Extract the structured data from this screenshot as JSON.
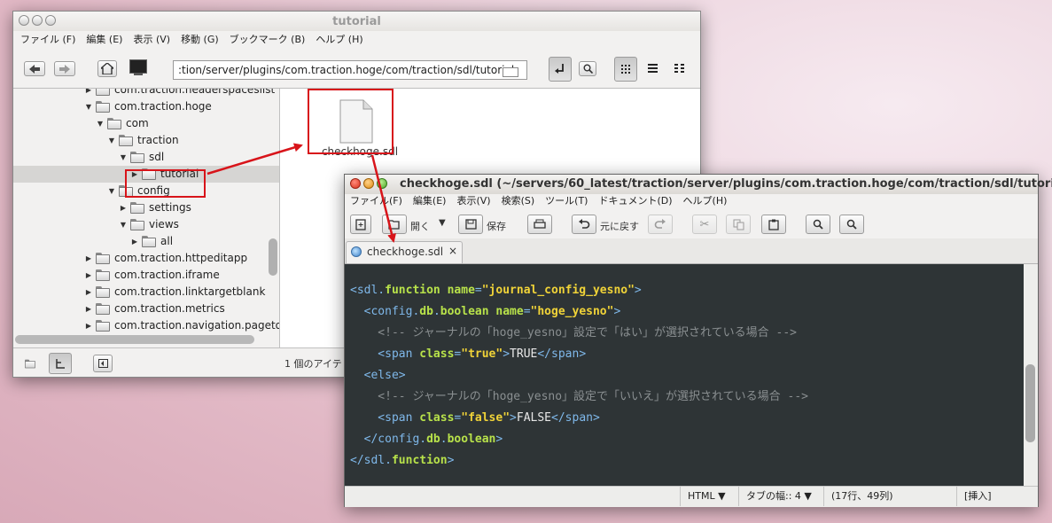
{
  "file_manager": {
    "title": "tutorial",
    "menu": [
      "ファイル (F)",
      "編集 (E)",
      "表示 (V)",
      "移動 (G)",
      "ブックマーク (B)",
      "ヘルプ (H)"
    ],
    "path": ":tion/server/plugins/com.traction.hoge/com/traction/sdl/tutorial",
    "tree": [
      {
        "label": "com.traction.headerspaceslist",
        "indent": 0,
        "expanded": false
      },
      {
        "label": "com.traction.hoge",
        "indent": 0,
        "expanded": true
      },
      {
        "label": "com",
        "indent": 1,
        "expanded": true
      },
      {
        "label": "traction",
        "indent": 2,
        "expanded": true
      },
      {
        "label": "sdl",
        "indent": 3,
        "expanded": true
      },
      {
        "label": "tutorial",
        "indent": 4,
        "expanded": false,
        "selected": true
      },
      {
        "label": "config",
        "indent": 2,
        "expanded": true
      },
      {
        "label": "settings",
        "indent": 3,
        "expanded": false
      },
      {
        "label": "views",
        "indent": 3,
        "expanded": true
      },
      {
        "label": "all",
        "indent": 4,
        "expanded": false
      },
      {
        "label": "com.traction.httpeditapp",
        "indent": 0,
        "expanded": false
      },
      {
        "label": "com.traction.iframe",
        "indent": 0,
        "expanded": false
      },
      {
        "label": "com.traction.linktargetblank",
        "indent": 0,
        "expanded": false
      },
      {
        "label": "com.traction.metrics",
        "indent": 0,
        "expanded": false
      },
      {
        "label": "com.traction.navigation.pageto",
        "indent": 0,
        "expanded": false
      }
    ],
    "file_name": "checkhoge.sdl",
    "status": "1 個のアイテ"
  },
  "editor": {
    "title": "checkhoge.sdl (~/servers/60_latest/traction/server/plugins/com.traction.hoge/com/traction/sdl/tutorial…",
    "menu": [
      "ファイル(F)",
      "編集(E)",
      "表示(V)",
      "検索(S)",
      "ツール(T)",
      "ドキュメント(D)",
      "ヘルプ(H)"
    ],
    "toolbar": {
      "open_label": "開く",
      "save_label": "保存",
      "undo_label": "元に戻す"
    },
    "tab_label": "checkhoge.sdl",
    "tab_close": "×",
    "status": {
      "language": "HTML",
      "tab_width": "タブの幅:: 4",
      "position": "(17行、49列)",
      "mode": "[挿入]"
    },
    "code_lines": [
      [
        [
          "tag",
          "<sdl."
        ],
        [
          "attr",
          "function"
        ],
        [
          "tag",
          " "
        ],
        [
          "attr",
          "name"
        ],
        [
          "tag",
          "="
        ],
        [
          "val",
          "\"journal_config_yesno\""
        ],
        [
          "tag",
          ">"
        ]
      ],
      [
        [
          "tag",
          "  <config."
        ],
        [
          "attr",
          "db"
        ],
        [
          "tag",
          "."
        ],
        [
          "attr",
          "boolean"
        ],
        [
          "tag",
          " "
        ],
        [
          "attr",
          "name"
        ],
        [
          "tag",
          "="
        ],
        [
          "val",
          "\"hoge_yesno\""
        ],
        [
          "tag",
          ">"
        ]
      ],
      [
        [
          "com",
          "    <!-- ジャーナルの「hoge_yesno」設定で「はい」が選択されている場合 -->"
        ]
      ],
      [
        [
          "tag",
          "    <span "
        ],
        [
          "attr",
          "class"
        ],
        [
          "tag",
          "="
        ],
        [
          "val",
          "\"true\""
        ],
        [
          "tag",
          ">"
        ],
        [
          "txt",
          "TRUE"
        ],
        [
          "tag",
          "</span>"
        ]
      ],
      [
        [
          "tag",
          "  <else>"
        ]
      ],
      [
        [
          "com",
          "    <!-- ジャーナルの「hoge_yesno」設定で「いいえ」が選択されている場合 -->"
        ]
      ],
      [
        [
          "tag",
          "    <span "
        ],
        [
          "attr",
          "class"
        ],
        [
          "tag",
          "="
        ],
        [
          "val",
          "\"false\""
        ],
        [
          "tag",
          ">"
        ],
        [
          "txt",
          "FALSE"
        ],
        [
          "tag",
          "</span>"
        ]
      ],
      [
        [
          "tag",
          "  </config."
        ],
        [
          "attr",
          "db"
        ],
        [
          "tag",
          "."
        ],
        [
          "attr",
          "boolean"
        ],
        [
          "tag",
          ">"
        ]
      ],
      [
        [
          "tag",
          "</sdl."
        ],
        [
          "attr",
          "function"
        ],
        [
          "tag",
          ">"
        ]
      ]
    ]
  }
}
